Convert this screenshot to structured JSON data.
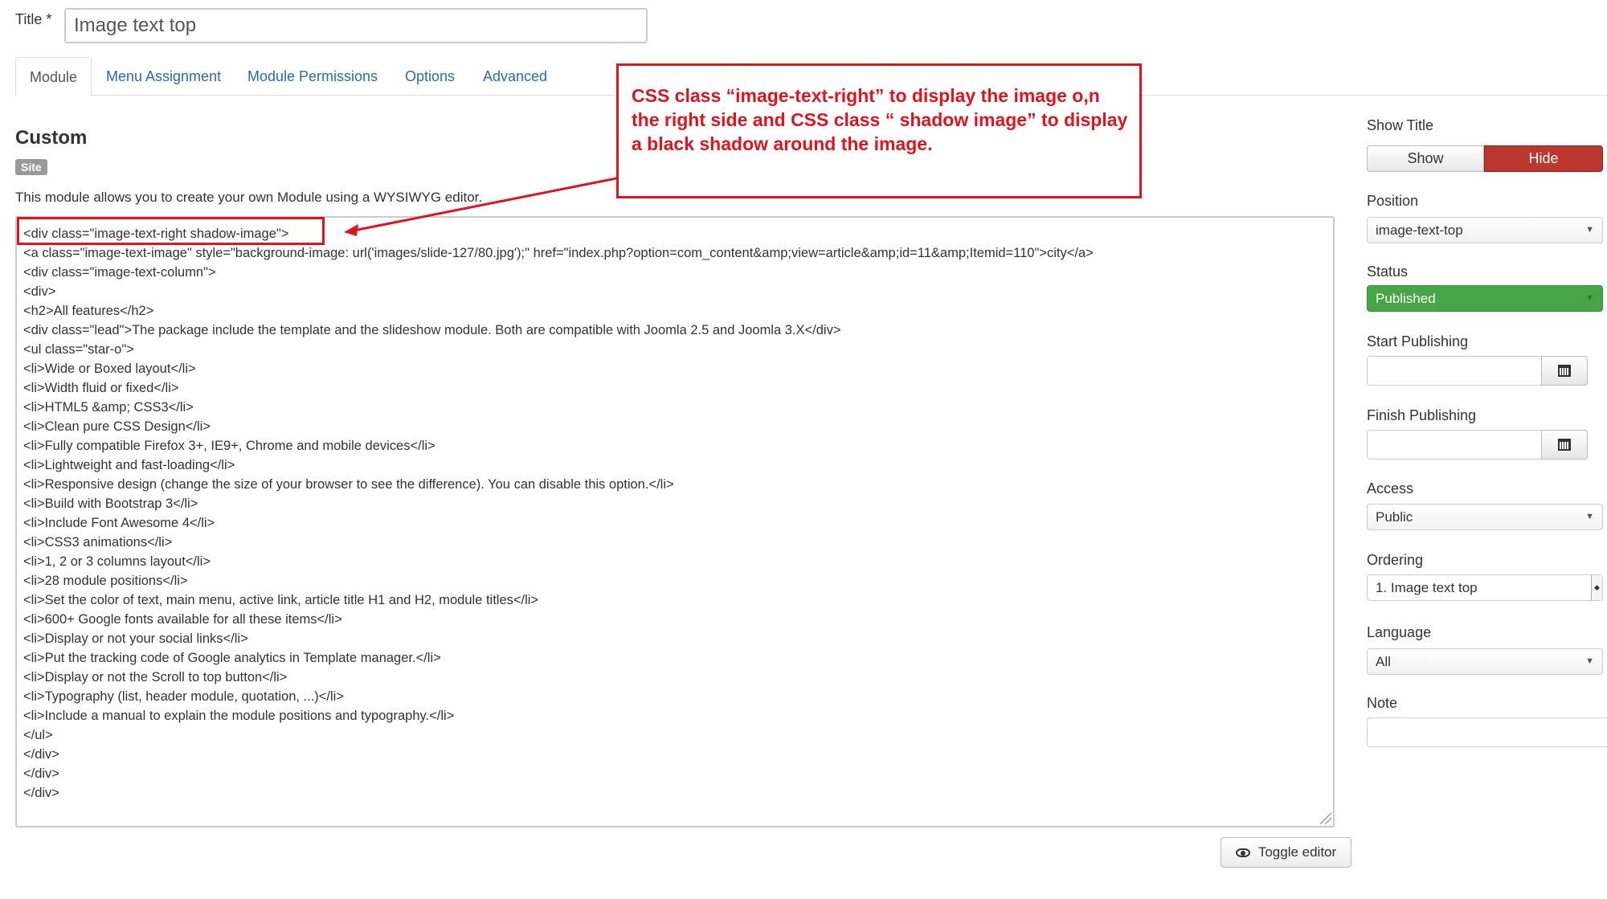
{
  "title_field": {
    "label": "Title *",
    "value": "Image text top"
  },
  "tabs": [
    {
      "label": "Module"
    },
    {
      "label": "Menu Assignment"
    },
    {
      "label": "Module Permissions"
    },
    {
      "label": "Options"
    },
    {
      "label": "Advanced"
    }
  ],
  "module": {
    "heading": "Custom",
    "badge": "Site",
    "description": "This module allows you to create your own Module using a WYSIWYG editor."
  },
  "editor": {
    "lines": [
      "<div class=\"image-text-right shadow-image\">",
      "<a class=\"image-text-image\" style=\"background-image: url('images/slide-127/80.jpg');\" href=\"index.php?option=com_content&amp;view=article&amp;id=11&amp;Itemid=110\">city</a>",
      "<div class=\"image-text-column\">",
      "<div>",
      "<h2>All features</h2>",
      "<div class=\"lead\">The package include the template and the slideshow module. Both are compatible with Joomla 2.5 and Joomla 3.X</div>",
      "<ul class=\"star-o\">",
      "<li>Wide or Boxed layout</li>",
      "<li>Width fluid or fixed</li>",
      "<li>HTML5 &amp; CSS3</li>",
      "<li>Clean pure CSS Design</li>",
      "<li>Fully compatible Firefox 3+, IE9+, Chrome and mobile devices</li>",
      "<li>Lightweight and fast-loading</li>",
      "<li>Responsive design (change the size of your browser to see the difference). You can disable this option.</li>",
      "<li>Build with Bootstrap 3</li>",
      "<li>Include Font Awesome 4</li>",
      "<li>CSS3 animations</li>",
      "<li>1, 2 or 3 columns layout</li>",
      "<li>28 module positions</li>",
      "<li>Set the color of text, main menu, active link, article title H1 and H2, module titles</li>",
      "<li>600+ Google fonts available for all these items</li>",
      "<li>Display or not your social links</li>",
      "<li>Put the tracking code of Google analytics in Template manager.</li>",
      "<li>Display or not the Scroll to top button</li>",
      "<li>Typography (list, header module, quotation, ...)</li>",
      "<li>Include a manual to explain the module positions and typography.</li>",
      "</ul>",
      "</div>",
      "</div>",
      "</div>"
    ],
    "toggle_label": "Toggle editor",
    "toggle_icon": "eye-icon"
  },
  "annotation": {
    "text": "CSS class “image-text-right” to display the image o,n the right side and CSS class “ shadow image” to display a black shadow around the image.",
    "color": "#e0141e"
  },
  "sidebar": {
    "show_title": {
      "label": "Show Title",
      "show": "Show",
      "hide": "Hide",
      "selected": "Hide"
    },
    "position": {
      "label": "Position",
      "value": "image-text-top"
    },
    "status": {
      "label": "Status",
      "value": "Published",
      "color": "#46a546"
    },
    "start_publishing": {
      "label": "Start Publishing",
      "value": "",
      "icon": "calendar-icon"
    },
    "finish_publishing": {
      "label": "Finish Publishing",
      "value": "",
      "icon": "calendar-icon"
    },
    "access": {
      "label": "Access",
      "value": "Public"
    },
    "ordering": {
      "label": "Ordering",
      "value": "1. Image text top"
    },
    "language": {
      "label": "Language",
      "value": "All"
    },
    "note": {
      "label": "Note",
      "value": ""
    }
  },
  "colors": {
    "link": "#2a69b8",
    "hide_button": "#bd362f",
    "annotation": "#e0141e"
  }
}
